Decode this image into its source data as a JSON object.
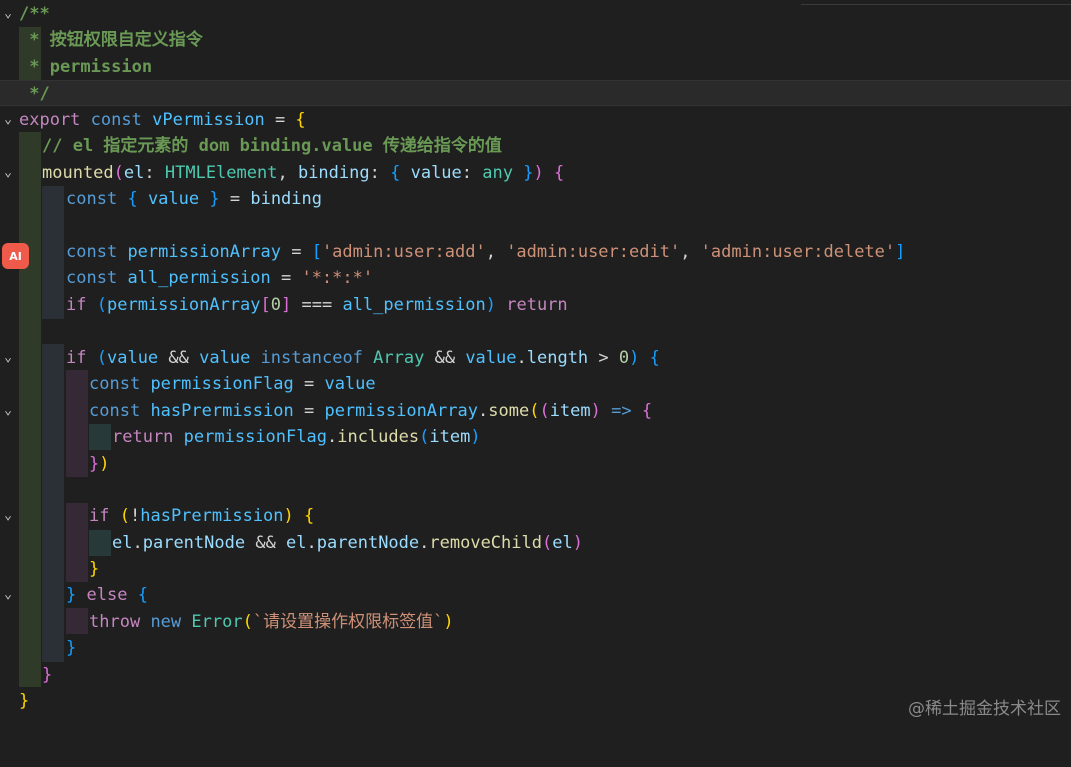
{
  "editor": {
    "watermark": "@稀土掘金技术社区",
    "ai_badge": "AI",
    "lines": {
      "l1": "/**",
      "l2": " * 按钮权限自定义指令",
      "l3": " * permission",
      "l4": " */",
      "l6": "// el 指定元素的 dom binding.value 传递给指令的值",
      "l11": "'admin:user:add'",
      "l11b": "'admin:user:edit'",
      "l11c": "'admin:user:delete'",
      "l12": "'*:*:*'",
      "l24": "`请设置操作权限标签值`"
    }
  }
}
